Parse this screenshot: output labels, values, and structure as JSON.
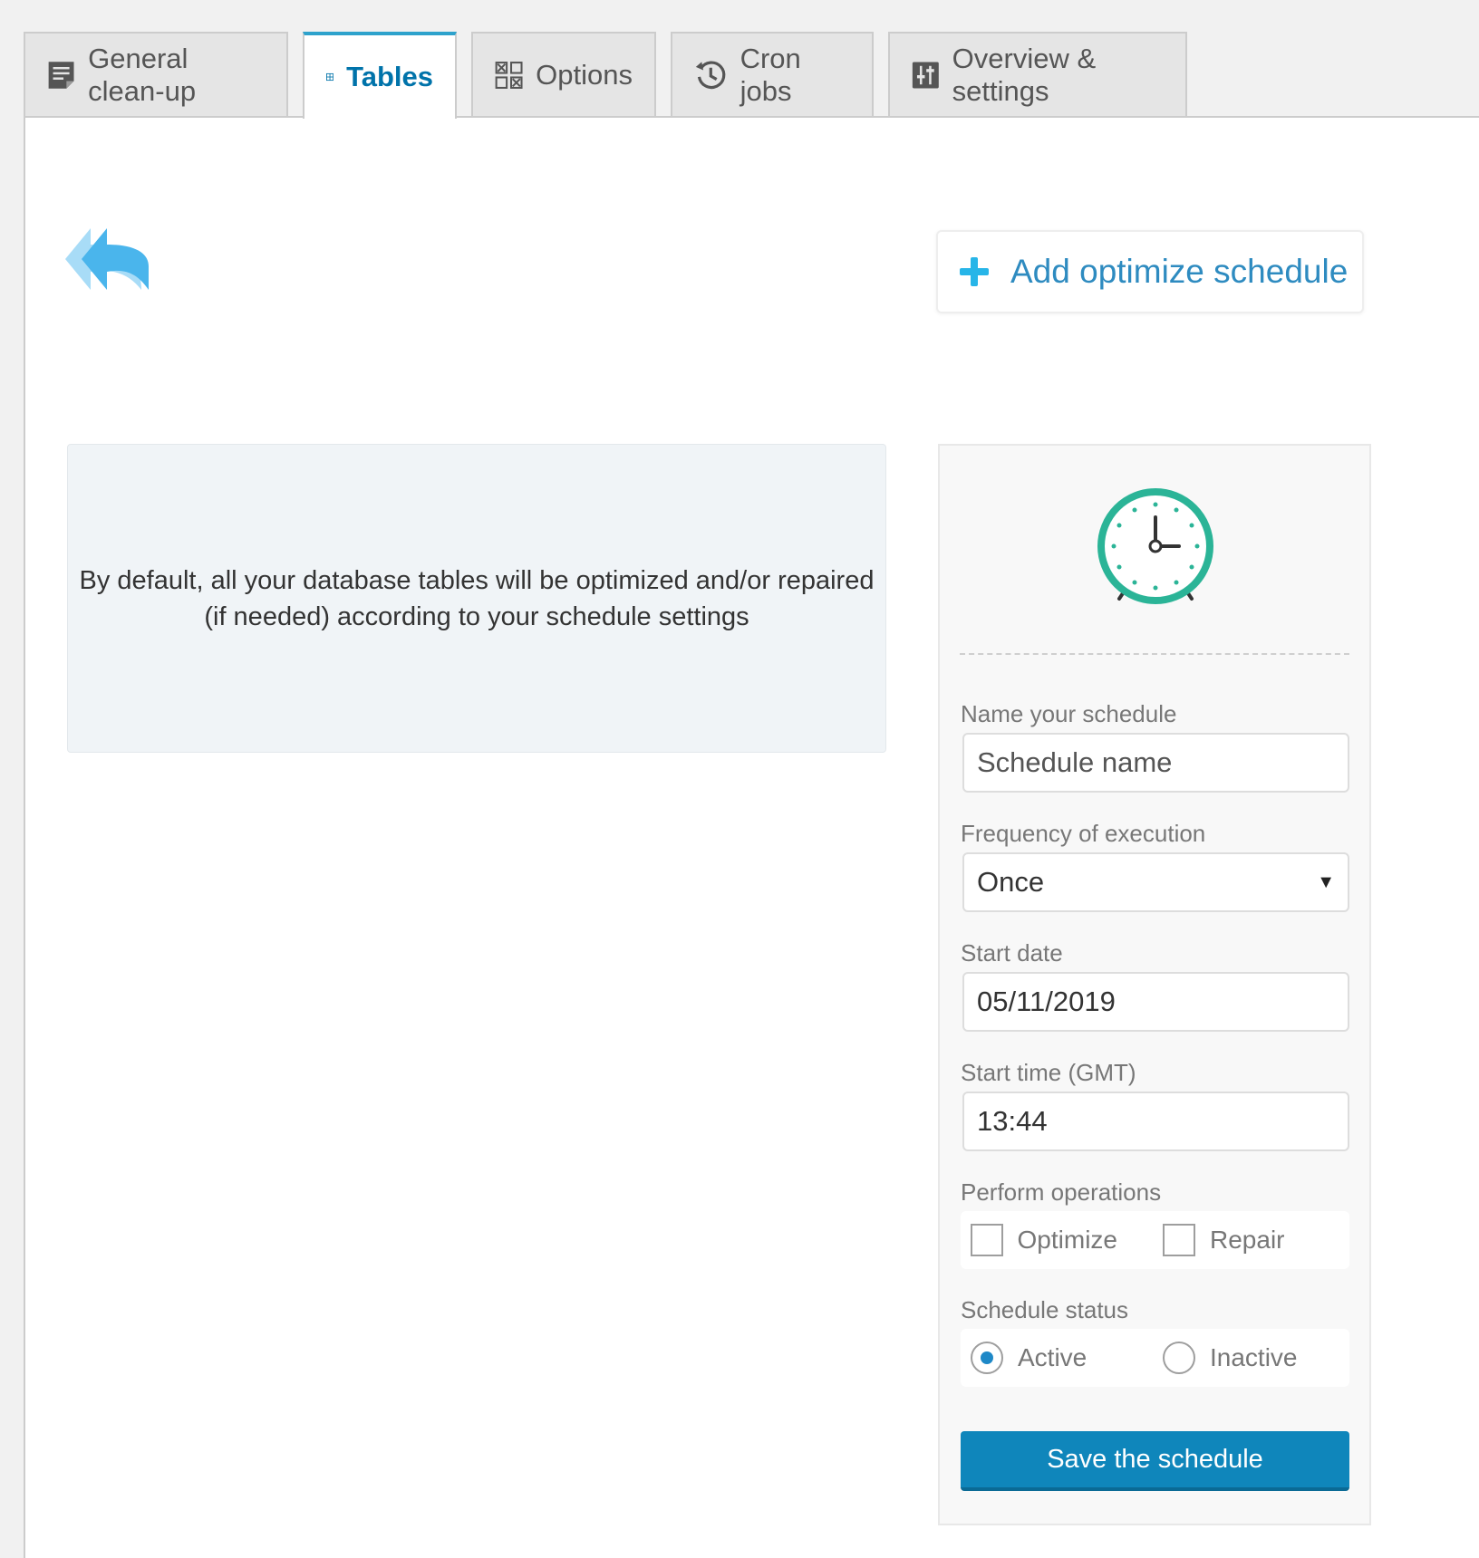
{
  "tabs": [
    {
      "label": "General clean-up",
      "icon": "document-icon",
      "active": false
    },
    {
      "label": "Tables",
      "icon": "table-grid-icon",
      "active": true
    },
    {
      "label": "Options",
      "icon": "options-grid-icon",
      "active": false
    },
    {
      "label": "Cron jobs",
      "icon": "history-icon",
      "active": false
    },
    {
      "label": "Overview & settings",
      "icon": "sliders-icon",
      "active": false
    }
  ],
  "main": {
    "add_schedule_label": "Add optimize schedule",
    "info_text": "By default, all your database tables will be optimized and/or repaired (if needed) according to your schedule settings"
  },
  "schedule_form": {
    "name_label": "Name your schedule",
    "name_placeholder": "Schedule name",
    "frequency_label": "Frequency of execution",
    "frequency_value": "Once",
    "start_date_label": "Start date",
    "start_date_value": "05/11/2019",
    "start_time_label": "Start time (GMT)",
    "start_time_value": "13:44",
    "operations_label": "Perform operations",
    "operations": [
      {
        "label": "Optimize",
        "checked": false
      },
      {
        "label": "Repair",
        "checked": false
      }
    ],
    "status_label": "Schedule status",
    "status_options": [
      {
        "label": "Active",
        "selected": true
      },
      {
        "label": "Inactive",
        "selected": false
      }
    ],
    "save_label": "Save the schedule"
  },
  "colors": {
    "accent": "#0073aa",
    "save_button": "#0f86bb",
    "add_icon": "#27b5e8",
    "clock": "#2bb497",
    "back_arrow": "#4ab5ec"
  }
}
